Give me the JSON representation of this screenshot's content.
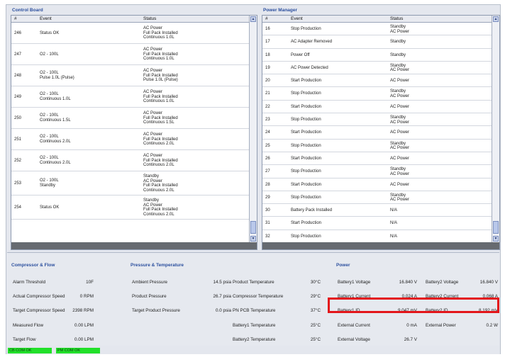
{
  "control_board": {
    "title": "Control Board",
    "columns": [
      "#",
      "Event",
      "Status"
    ],
    "rows": [
      {
        "id": "246",
        "event": [
          "Status OK"
        ],
        "status": [
          "AC Power",
          "Full Pack Installed",
          "Continuous 1.0L"
        ]
      },
      {
        "id": "247",
        "event": [
          "O2 - 100L"
        ],
        "status": [
          "AC Power",
          "Full Pack Installed",
          "Continuous 1.0L"
        ]
      },
      {
        "id": "248",
        "event": [
          "O2 - 100L",
          "Pulse 1.0L (Pulse)"
        ],
        "status": [
          "AC Power",
          "Full Pack Installed",
          "Pulse 1.0L (Pulse)"
        ]
      },
      {
        "id": "249",
        "event": [
          "O2 - 100L",
          "Continuous 1.0L"
        ],
        "status": [
          "AC Power",
          "Full Pack Installed",
          "Continuous 1.0L"
        ]
      },
      {
        "id": "250",
        "event": [
          "O2 - 100L",
          "Continuous 1.5L"
        ],
        "status": [
          "AC Power",
          "Full Pack Installed",
          "Continuous 1.5L"
        ]
      },
      {
        "id": "251",
        "event": [
          "O2 - 100L",
          "Continuous 2.0L"
        ],
        "status": [
          "AC Power",
          "Full Pack Installed",
          "Continuous 2.0L"
        ]
      },
      {
        "id": "252",
        "event": [
          "O2 - 100L",
          "Continuous 2.0L"
        ],
        "status": [
          "AC Power",
          "Full Pack Installed",
          "Continuous 2.0L"
        ]
      },
      {
        "id": "253",
        "event": [
          "O2 - 100L",
          "Standby"
        ],
        "status": [
          "Standby",
          "AC Power",
          "Full Pack Installed",
          "Continuous 2.0L"
        ]
      },
      {
        "id": "254",
        "event": [
          "Status OK"
        ],
        "status": [
          "Standby",
          "AC Power",
          "Full Pack Installed",
          "Continuous 2.0L"
        ]
      }
    ]
  },
  "power_manager": {
    "title": "Power Manager",
    "columns": [
      "#",
      "Event",
      "Status"
    ],
    "rows": [
      {
        "id": "16",
        "event": "Stop Production",
        "status": [
          "Standby",
          "AC Power"
        ]
      },
      {
        "id": "17",
        "event": "AC Adapter Removed",
        "status": [
          "Standby"
        ]
      },
      {
        "id": "18",
        "event": "Power Off",
        "status": [
          "Standby"
        ]
      },
      {
        "id": "19",
        "event": "AC Power Detected",
        "status": [
          "Standby",
          "AC Power"
        ]
      },
      {
        "id": "20",
        "event": "Start Production",
        "status": [
          "AC Power"
        ]
      },
      {
        "id": "21",
        "event": "Stop Production",
        "status": [
          "Standby",
          "AC Power"
        ]
      },
      {
        "id": "22",
        "event": "Start Production",
        "status": [
          "AC Power"
        ]
      },
      {
        "id": "23",
        "event": "Stop Production",
        "status": [
          "Standby",
          "AC Power"
        ]
      },
      {
        "id": "24",
        "event": "Start Production",
        "status": [
          "AC Power"
        ]
      },
      {
        "id": "25",
        "event": "Stop Production",
        "status": [
          "Standby",
          "AC Power"
        ]
      },
      {
        "id": "26",
        "event": "Start Production",
        "status": [
          "AC Power"
        ]
      },
      {
        "id": "27",
        "event": "Stop Production",
        "status": [
          "Standby",
          "AC Power"
        ]
      },
      {
        "id": "28",
        "event": "Start Production",
        "status": [
          "AC Power"
        ]
      },
      {
        "id": "29",
        "event": "Stop Production",
        "status": [
          "Standby",
          "AC Power"
        ]
      },
      {
        "id": "30",
        "event": "Battery Pack Installed",
        "status": [
          "N/A"
        ]
      },
      {
        "id": "31",
        "event": "Start Production",
        "status": [
          "N/A"
        ]
      },
      {
        "id": "32",
        "event": "Stop Production",
        "status": [
          "N/A"
        ]
      }
    ]
  },
  "compressor": {
    "title": "Compressor & Flow",
    "items": [
      {
        "label": "Alarm Threshold",
        "value": "10F"
      },
      {
        "label": "Actual Compressor Speed",
        "value": "0 RPM"
      },
      {
        "label": "Target Compressor Speed",
        "value": "2398 RPM"
      },
      {
        "label": "Measured Flow",
        "value": "0.00 LPM"
      },
      {
        "label": "Target Flow",
        "value": "0.00 LPM"
      }
    ]
  },
  "pressure": {
    "title": "Pressure & Temperature",
    "left": [
      {
        "label": "Ambient Pressure",
        "value": "14.5 psia"
      },
      {
        "label": "Product Pressure",
        "value": "26.7 psia"
      },
      {
        "label": "Target Product Pressure",
        "value": "0.0 psia"
      }
    ],
    "right": [
      {
        "label": "Product Temperature",
        "value": "30°C"
      },
      {
        "label": "Compressor Temperature",
        "value": "29°C"
      },
      {
        "label": "PN PCB Temperature",
        "value": "37°C"
      },
      {
        "label": "Battery1 Temperature",
        "value": "25°C"
      },
      {
        "label": "Battery2 Temperature",
        "value": "25°C"
      }
    ]
  },
  "power": {
    "title": "Power",
    "rows": [
      [
        {
          "label": "Battery1 Voltage",
          "value": "16.840 V"
        },
        {
          "label": "Battery2 Voltage",
          "value": "16.840 V"
        }
      ],
      [
        {
          "label": "Battery1 Current",
          "value": "0.024 A"
        },
        {
          "label": "Battery2 Current",
          "value": "0.068 A"
        }
      ],
      [
        {
          "label": "Battery1 ID",
          "value": "9,047 mV"
        },
        {
          "label": "Battery2 ID",
          "value": "8,192 mV"
        }
      ],
      [
        {
          "label": "External Current",
          "value": "0 mA"
        },
        {
          "label": "External Power",
          "value": "0.2 W"
        }
      ],
      [
        {
          "label": "External Voltage",
          "value": "26.7 V"
        }
      ]
    ]
  },
  "status_bar": {
    "indicators": [
      "CB COM OK",
      "PM COM OK"
    ],
    "indicator_color": "#22e02a"
  },
  "colors": {
    "title_blue": "#2b4f9e",
    "highlight_red": "#e3161b"
  }
}
